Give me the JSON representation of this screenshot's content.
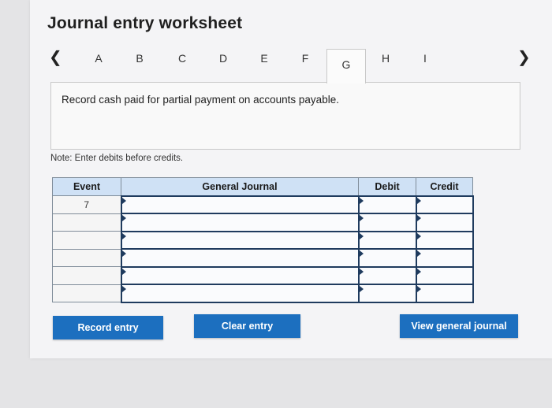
{
  "title": "Journal entry worksheet",
  "tabs": [
    "A",
    "B",
    "C",
    "D",
    "E",
    "F",
    "G",
    "H",
    "I"
  ],
  "active_tab": "G",
  "instruction": "Record cash paid for partial payment on accounts payable.",
  "note": "Note: Enter debits before credits.",
  "table": {
    "headers": {
      "event": "Event",
      "journal": "General Journal",
      "debit": "Debit",
      "credit": "Credit"
    },
    "event_number": "7",
    "rows": 6
  },
  "buttons": {
    "record": "Record entry",
    "clear": "Clear entry",
    "view": "View general journal"
  },
  "colors": {
    "button": "#1c6fbf",
    "header": "#cfe1f5"
  }
}
